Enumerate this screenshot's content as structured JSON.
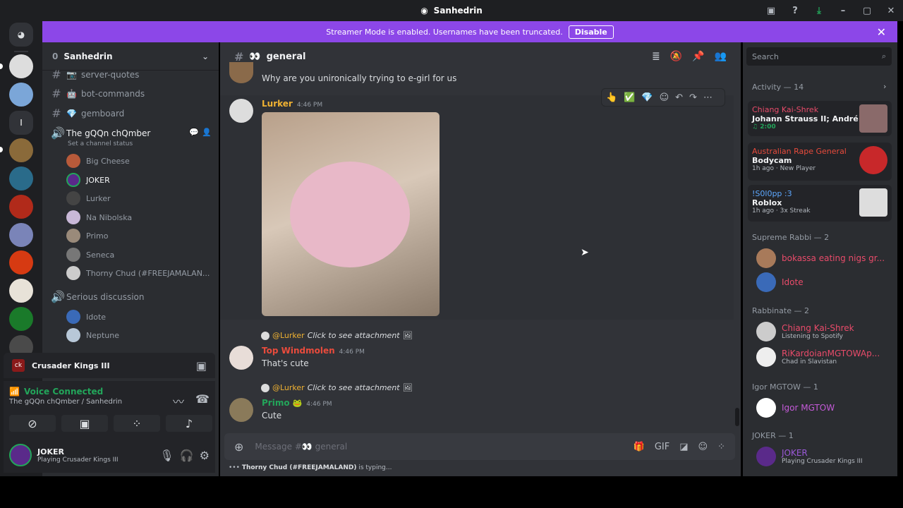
{
  "window": {
    "title": "Sanhedrin"
  },
  "banner": {
    "text": "Streamer Mode is enabled. Usernames have been truncated.",
    "button": "Disable"
  },
  "server": {
    "name": "Sanhedrin",
    "badge": "0"
  },
  "channels": [
    {
      "name": "server-quotes",
      "emoji": "📷"
    },
    {
      "name": "bot-commands",
      "emoji": "🤖"
    },
    {
      "name": "gemboard",
      "emoji": "💎"
    }
  ],
  "voice": {
    "name": "The gQQn chQmber",
    "status_hint": "Set a channel status",
    "users": [
      "Big Cheese",
      "JOKER",
      "Lurker",
      "Na Nibolska",
      "Primo",
      "Seneca",
      "Thorny Chud (#FREEJAMALAN..."
    ]
  },
  "voice2": {
    "name": "Serious discussion",
    "users": [
      "Idote",
      "Neptune"
    ]
  },
  "game_panel": {
    "title": "Crusader Kings III"
  },
  "voice_panel": {
    "status": "Voice Connected",
    "channel": "The gQQn chQmber / Sanhedrin"
  },
  "user_panel": {
    "name": "JOKER",
    "status": "Playing Crusader Kings III"
  },
  "channel": {
    "name": "general",
    "emoji": "👀"
  },
  "messages": {
    "m0": {
      "text": "Why are you unironically trying to e-girl for us"
    },
    "m1": {
      "author": "Lurker",
      "time": "4:46 PM"
    },
    "m2": {
      "reply_to": "@Lurker",
      "reply_text": "Click to see attachment",
      "author": "Top Windmolen",
      "time": "4:46 PM",
      "text": "That's cute"
    },
    "m3": {
      "reply_to": "@Lurker",
      "reply_text": "Click to see attachment",
      "author": "Primo",
      "time": "4:46 PM",
      "text": "Cute"
    }
  },
  "composer": {
    "placeholder": "Message #👀 general"
  },
  "typing": {
    "user": "Thorny Chud (#FREEJAMALAND)",
    "text": " is typing..."
  },
  "search": {
    "placeholder": "Search"
  },
  "activity": {
    "header": "Activity — 14",
    "cards": [
      {
        "user": "Chiang Kai-Shrek",
        "title": "Johann Strauss II; André Ri...",
        "meta": "♫ 2:00"
      },
      {
        "user": "Australian Rape General",
        "title": "Bodycam",
        "meta": "1h ago",
        "extra": "New Player"
      },
      {
        "user": "!S0l0pp :3",
        "title": "Roblox",
        "meta": "1h ago",
        "extra": "3x Streak"
      }
    ]
  },
  "groups": [
    {
      "header": "Supreme Rabbi — 2",
      "members": [
        {
          "name": "bokassa eating nigs gr...",
          "sub": ""
        },
        {
          "name": "Idote",
          "sub": ""
        }
      ]
    },
    {
      "header": "Rabbinate — 2",
      "members": [
        {
          "name": "Chiang Kai-Shrek",
          "sub": "Listening to Spotify"
        },
        {
          "name": "RiKardoianMGTOWAp...",
          "sub": "Chad in Slavistan"
        }
      ]
    },
    {
      "header": "Igor MGTOW — 1",
      "members": [
        {
          "name": "Igor MGTOW",
          "sub": ""
        }
      ]
    },
    {
      "header": "JOKER — 1",
      "members": [
        {
          "name": "JOKER",
          "sub": "Playing Crusader Kings III"
        }
      ]
    }
  ]
}
